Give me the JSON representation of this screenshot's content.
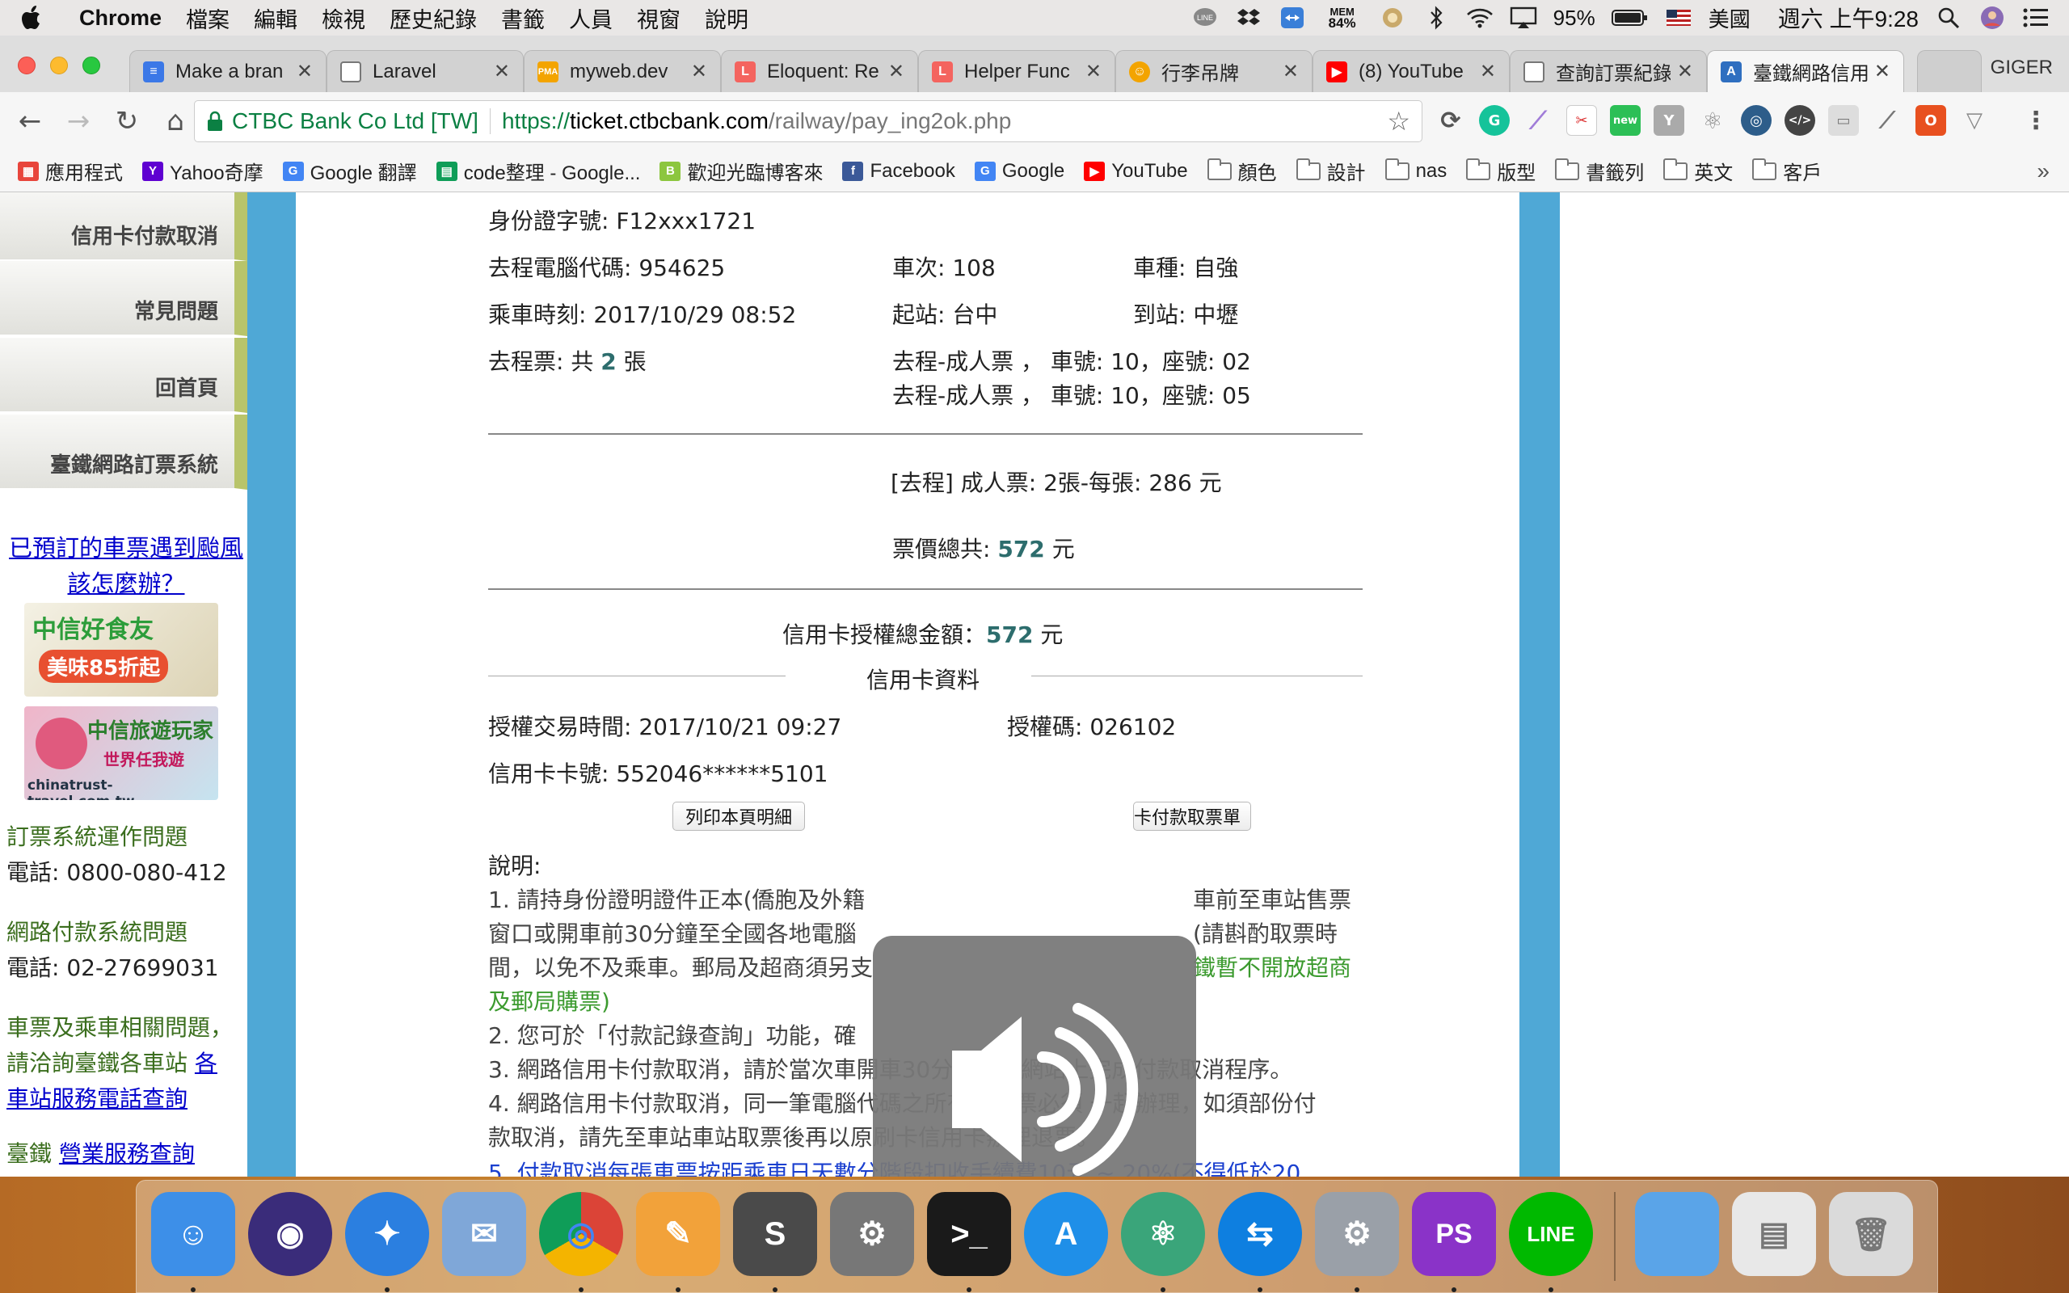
{
  "menubar": {
    "app": "Chrome",
    "items": [
      "檔案",
      "編輯",
      "檢視",
      "歷史紀錄",
      "書籤",
      "人員",
      "視窗",
      "說明"
    ],
    "mem_label": "MEM",
    "mem_value": "84%",
    "battery": "95%",
    "input_source": "美國",
    "clock": "週六 上午9:28"
  },
  "tabs": [
    {
      "title": "Make a bran",
      "favicon_color": "#3b78e7",
      "icon": "doc-icon"
    },
    {
      "title": "Laravel",
      "favicon_color": "#ffffff",
      "icon": "page-icon"
    },
    {
      "title": "myweb.dev",
      "favicon_color": "#f3a400",
      "icon": "pma-icon"
    },
    {
      "title": "Eloquent: Re",
      "favicon_color": "#f4645f",
      "icon": "laravel-icon"
    },
    {
      "title": "Helper Func",
      "favicon_color": "#f4645f",
      "icon": "laravel-icon"
    },
    {
      "title": "行李吊牌",
      "favicon_color": "#f3a400",
      "icon": "smiley-icon"
    },
    {
      "title": "(8) YouTube",
      "favicon_color": "#ff0000",
      "icon": "youtube-icon"
    },
    {
      "title": "查詢訂票紀錄",
      "favicon_color": "#ffffff",
      "icon": "page-icon"
    },
    {
      "title": "臺鐵網路信用",
      "favicon_color": "#2f6fc0",
      "icon": "railway-icon",
      "active": true
    }
  ],
  "profile_name": "GIGER",
  "omnibox": {
    "secure_label": "CTBC Bank Co Ltd [TW]",
    "proto": "https://",
    "host": "ticket.ctbcbank.com",
    "path": "/railway/pay_ing2ok.php"
  },
  "bookmarks": [
    {
      "label": "應用程式",
      "icon": "apps-icon",
      "color": "#e8453c"
    },
    {
      "label": "Yahoo奇摩",
      "icon": "yahoo-icon",
      "color": "#5f01d1"
    },
    {
      "label": "Google 翻譯",
      "icon": "translate-icon",
      "color": "#4285f4"
    },
    {
      "label": "code整理 - Google...",
      "icon": "sheets-icon",
      "color": "#0f9d58"
    },
    {
      "label": "歡迎光臨博客來",
      "icon": "books-icon",
      "color": "#8cc63f"
    },
    {
      "label": "Facebook",
      "icon": "facebook-icon",
      "color": "#3b5998"
    },
    {
      "label": "Google",
      "icon": "google-icon",
      "color": "#4285f4"
    },
    {
      "label": "YouTube",
      "icon": "youtube-icon",
      "color": "#ff0000"
    },
    {
      "label": "顏色",
      "icon": "folder-icon"
    },
    {
      "label": "設計",
      "icon": "folder-icon"
    },
    {
      "label": "nas",
      "icon": "folder-icon"
    },
    {
      "label": "版型",
      "icon": "folder-icon"
    },
    {
      "label": "書籤列",
      "icon": "folder-icon"
    },
    {
      "label": "英文",
      "icon": "folder-icon"
    },
    {
      "label": "客戶",
      "icon": "folder-icon"
    }
  ],
  "sidebar": {
    "nav": [
      "信用卡付款取消",
      "常見問題",
      "回首頁",
      "臺鐵網路訂票系統"
    ],
    "typhoon_link": "已預訂的車票遇到颱風該怎麼辦？",
    "banner1": {
      "title": "中信好食友",
      "subtitle": "美味85折起"
    },
    "banner2": {
      "title": "中信旅遊玩家",
      "subtitle": "世界任我遊",
      "url": "chinatrust-travel.com.tw"
    },
    "booking_issue": "訂票系統運作問題",
    "booking_phone": "電話: 0800-080-412",
    "payment_issue": "網路付款系統問題",
    "payment_phone": "電話: 02-27699031",
    "ticket_issue_1": "車票及乘車相關問題，",
    "ticket_issue_2": "請洽詢臺鐵各車站",
    "ticket_issue_link_a": "各",
    "ticket_issue_link_b": "車站服務電話查詢",
    "tra_label": "臺鐵",
    "tra_link": "營業服務查詢"
  },
  "ticket": {
    "id_label": "身份證字號: F12xxx1721",
    "code_label": "去程電腦代碼: 954625",
    "train_no": "車次: 108",
    "train_type": "車種: 自強",
    "ride_time": "乘車時刻: 2017/10/29 08:52",
    "from": "起站: 台中",
    "to": "到站: 中壢",
    "count_prefix": "去程票: 共",
    "count": "2",
    "count_suffix": "張",
    "seat1": "去程-成人票 ， 車號: 10，座號: 02",
    "seat2": "去程-成人票 ， 車號: 10，座號: 05",
    "fare_detail": "[去程] 成人票: 2張-每張: 286 元",
    "total_label": "票價總共:",
    "total_value": "572",
    "total_unit": "元",
    "auth_total_label": "信用卡授權總金額：",
    "auth_total_value": "572",
    "auth_total_unit": "元",
    "card_section": "信用卡資料",
    "auth_time": "授權交易時間: 2017/10/21 09:27",
    "auth_code": "授權碼: 026102",
    "card_no": "信用卡卡號: 552046******5101",
    "print_btn": "列印本頁明細",
    "cancel_btn_partial": "卡付款取票單"
  },
  "notes": {
    "heading": "說明:",
    "n1_a": "1. 請持身份證明證件正本(僑胞及外籍",
    "n1_a_right": "車前至車站售票",
    "n1_b": "窗口或開車前30分鐘至全國各地電腦",
    "n1_b_right": "(請斟酌取票時",
    "n1_c": "間，以免不及乘車。郵局及超商須另支",
    "n1_c_right": "鐵暫不開放超商",
    "n1_d": "及郵局購票)",
    "n2": "2. 您可於「付款記錄查詢」功能，確",
    "n3": "3. 網路信用卡付款取消，請於當次車開車30分鐘前在網站上完成付款取消程序。",
    "n4_a": "4. 網路信用卡付款取消，同一筆電腦代碼之所有乘車票必須 一起辦理，如須部份付",
    "n4_b": "款取消，請先至車站車站取票後再以原刷卡信用卡辦理退票。",
    "n5": "5. 付款取消每張車票按距乘車日天數分階段扣收手續費10元 ~ 20%(不得低於20"
  },
  "volume_hud": {
    "level": 0.8,
    "segments": 16
  },
  "dock": [
    {
      "name": "Finder",
      "icon": "finder-icon",
      "color": "#3d8fe8",
      "running": true
    },
    {
      "name": "Siri",
      "icon": "siri-icon",
      "color": "#3a2c7a",
      "running": false
    },
    {
      "name": "Safari",
      "icon": "safari-icon",
      "color": "#2b7fe0",
      "running": true
    },
    {
      "name": "Mail",
      "icon": "mail-icon",
      "color": "#7fa7d8",
      "running": false
    },
    {
      "name": "Chrome",
      "icon": "chrome-icon",
      "color": "#e8e8e8",
      "running": true
    },
    {
      "name": "Pages",
      "icon": "pages-icon",
      "color": "#f2a23a",
      "running": true
    },
    {
      "name": "Sublime Text",
      "icon": "sublime-icon",
      "color": "#4a4a4a",
      "running": true
    },
    {
      "name": "System Preferences",
      "icon": "system-prefs-icon",
      "color": "#777777",
      "running": false
    },
    {
      "name": "Terminal",
      "icon": "terminal-icon",
      "color": "#1a1a1a",
      "running": true
    },
    {
      "name": "App Store",
      "icon": "app-store-icon",
      "color": "#1f8fe8",
      "running": false
    },
    {
      "name": "Atom",
      "icon": "atom-icon",
      "color": "#3aa57a",
      "running": true
    },
    {
      "name": "TeamViewer",
      "icon": "teamviewer-icon",
      "color": "#0e7fe0",
      "running": true
    },
    {
      "name": "Preferences",
      "icon": "gear-icon",
      "color": "#9aa0a8",
      "running": true
    },
    {
      "name": "PhpStorm",
      "icon": "phpstorm-icon",
      "color": "#8a33c8",
      "running": true
    },
    {
      "name": "LINE",
      "icon": "line-icon",
      "color": "#00b900",
      "running": true
    },
    {
      "name": "Downloads",
      "icon": "folder-icon",
      "color": "#5aa4e8",
      "running": false
    },
    {
      "name": "Preview Stack",
      "icon": "stack-icon",
      "color": "#e8e8e8",
      "running": false
    },
    {
      "name": "Trash",
      "icon": "trash-icon",
      "color": "#dadada",
      "running": false
    }
  ]
}
